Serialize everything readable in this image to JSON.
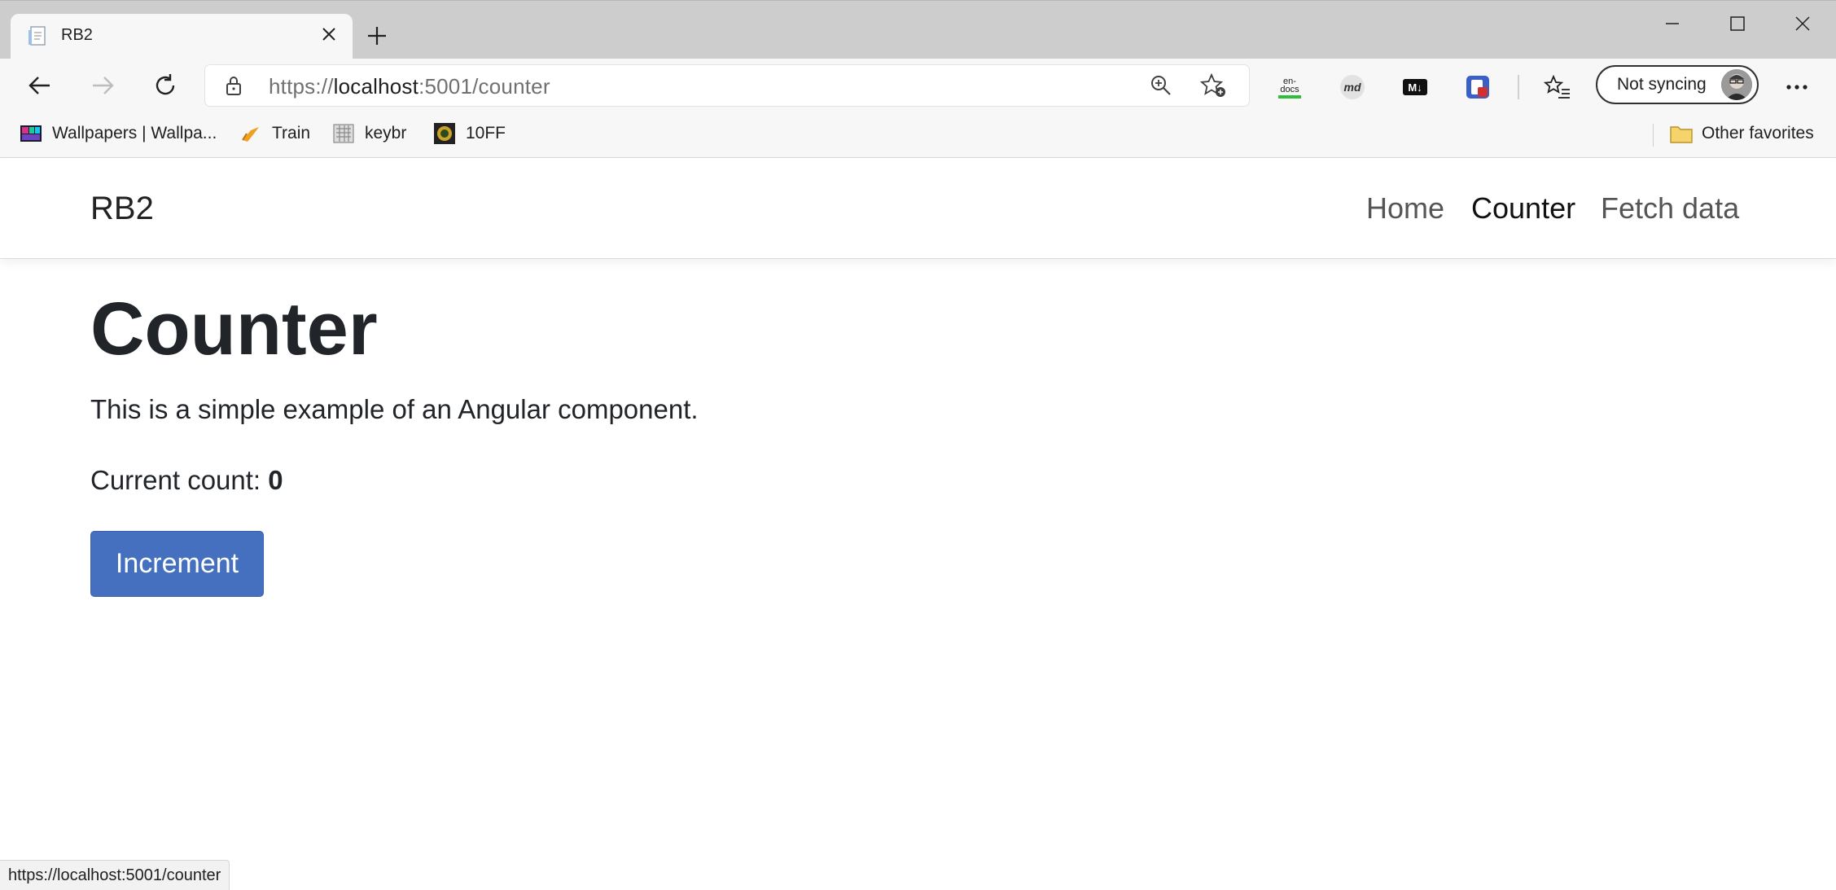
{
  "browser": {
    "tab_title": "RB2",
    "address": {
      "scheme": "https://",
      "host": "localhost",
      "rest": ":5001/counter"
    },
    "profile_label": "Not syncing",
    "bookmarks": [
      {
        "label": "Wallpapers | Wallpa...",
        "icon": "wallpapers-icon"
      },
      {
        "label": "Train",
        "icon": "train-icon"
      },
      {
        "label": "keybr",
        "icon": "keybr-icon"
      },
      {
        "label": "10FF",
        "icon": "10ff-icon"
      }
    ],
    "other_favorites": "Other favorites",
    "status_url": "https://localhost:5001/counter",
    "extensions": [
      "en-docs-icon",
      "md-icon",
      "markdown-icon",
      "extension-icon"
    ],
    "ext_text": {
      "endocs_top": "en-",
      "endocs_bottom": "docs",
      "md": "md",
      "markdown": "M↓"
    }
  },
  "app": {
    "brand": "RB2",
    "nav": [
      {
        "label": "Home",
        "active": false
      },
      {
        "label": "Counter",
        "active": true
      },
      {
        "label": "Fetch data",
        "active": false
      }
    ]
  },
  "page": {
    "heading": "Counter",
    "description": "This is a simple example of an Angular component.",
    "count_label": "Current count: ",
    "count_value": "0",
    "button_label": "Increment"
  },
  "colors": {
    "button": "#4470bf",
    "tabstrip": "#cdcdcd",
    "toolbar": "#f7f7f7"
  }
}
